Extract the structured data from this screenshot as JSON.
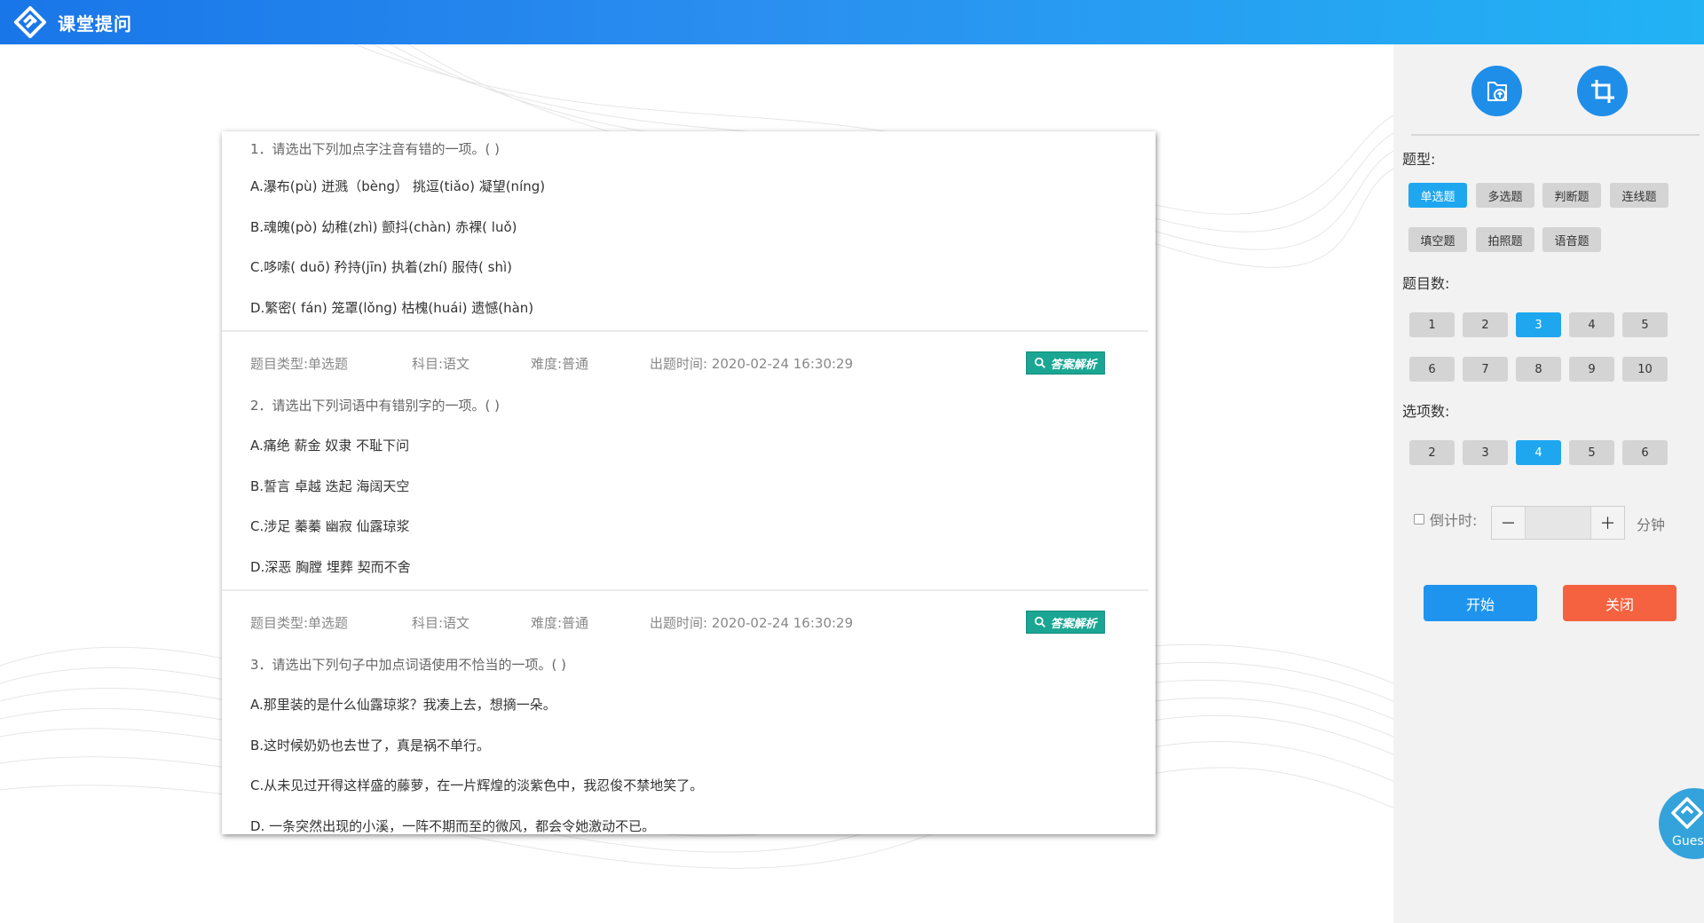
{
  "header": {
    "title": "课堂提问",
    "logo_icon": "diamond-logo-icon"
  },
  "questions": [
    {
      "title": "1．请选出下列加点字注音有错的一项。( )",
      "options": [
        "A.瀑布(pù) 迸溅（bèng） 挑逗(tiǎo) 凝望(níng)",
        "B.魂魄(pò) 幼稚(zhì) 颤抖(chàn) 赤裸( luǒ)",
        "C.哆嗦( duō) 矜持(jīn) 执着(zhí) 服侍( shì)",
        "D.繁密( fán) 笼罩(lǒng) 枯槐(huái) 遗憾(hàn)"
      ]
    },
    {
      "meta": {
        "type": "题目类型:单选题",
        "subject": "科目:语文",
        "difficulty": "难度:普通",
        "time": "出题时间: 2020-02-24 16:30:29",
        "analysis_label": "答案解析"
      },
      "title": "2．请选出下列词语中有错别字的一项。( )",
      "options": [
        "A.痛绝 薪金 奴隶 不耻下问",
        "B.誓言 卓越 迭起 海阔天空",
        "C.涉足 蓁蓁 幽寂 仙露琼浆",
        "D.深恶 胸膛 埋葬 契而不舍"
      ]
    },
    {
      "meta": {
        "type": "题目类型:单选题",
        "subject": "科目:语文",
        "difficulty": "难度:普通",
        "time": "出题时间: 2020-02-24 16:30:29",
        "analysis_label": "答案解析"
      },
      "title": "3．请选出下列句子中加点词语使用不恰当的一项。( )",
      "options": [
        "A.那里装的是什么仙露琼浆？我凑上去，想摘一朵。",
        "B.这时候奶奶也去世了，真是祸不单行。",
        "C.从未见过开得这样盛的藤萝，在一片辉煌的淡紫色中，我忍俊不禁地笑了。",
        "D. 一条突然出现的小溪，一阵不期而至的微风，都会令她激动不已。"
      ]
    }
  ],
  "sidebar": {
    "tools": {
      "upload_icon": "folder-upload-icon",
      "crop_icon": "crop-icon"
    },
    "type_label": "题型:",
    "types": [
      "单选题",
      "多选题",
      "判断题",
      "连线题",
      "填空题",
      "拍照题",
      "语音题"
    ],
    "type_selected": "单选题",
    "count_label": "题目数:",
    "counts": [
      "1",
      "2",
      "3",
      "4",
      "5",
      "6",
      "7",
      "8",
      "9",
      "10"
    ],
    "count_selected": "3",
    "option_label": "选项数:",
    "options": [
      "2",
      "3",
      "4",
      "5",
      "6"
    ],
    "option_selected": "4",
    "countdown_label": "倒计时:",
    "minus": "－",
    "plus": "＋",
    "countdown_value": "",
    "unit": "分钟",
    "start_label": "开始",
    "close_label": "关闭"
  },
  "guest": {
    "label": "Gues"
  },
  "colors": {
    "accent": "#1ea7ef",
    "start": "#1f94ef",
    "close": "#f46240",
    "analysis": "#1aa693"
  }
}
